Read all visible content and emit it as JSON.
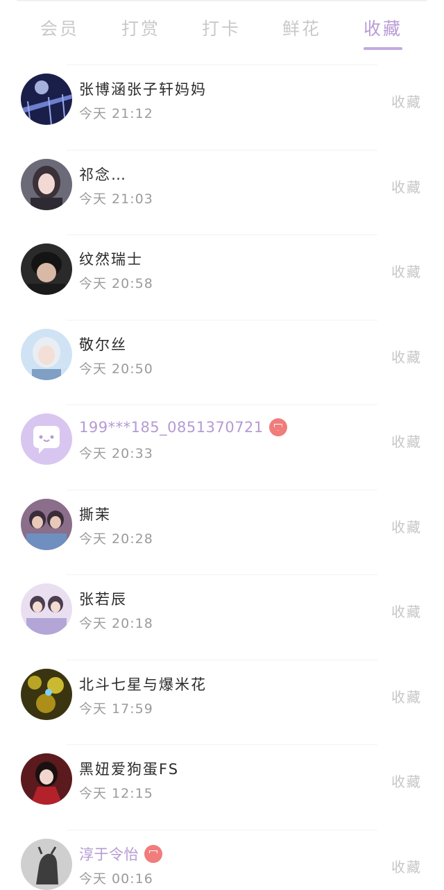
{
  "tabs": [
    {
      "label": "会员",
      "active": false
    },
    {
      "label": "打赏",
      "active": false
    },
    {
      "label": "打卡",
      "active": false
    },
    {
      "label": "鲜花",
      "active": false
    },
    {
      "label": "收藏",
      "active": true
    }
  ],
  "accent_color": "#b89bd6",
  "vip_badge_color": "#f07c7c",
  "items": [
    {
      "name": "张博涵张子轩妈妈",
      "time": "今天 21:12",
      "action": "收藏",
      "vip": false,
      "avatar": "night-bridge-photo"
    },
    {
      "name": "祁念…",
      "time": "今天 21:03",
      "action": "收藏",
      "vip": false,
      "avatar": "girl-portrait-photo"
    },
    {
      "name": "纹然瑞士",
      "time": "今天 20:58",
      "action": "收藏",
      "vip": false,
      "avatar": "boy-portrait-photo"
    },
    {
      "name": "敬尔丝",
      "time": "今天 20:50",
      "action": "收藏",
      "vip": false,
      "avatar": "light-hair-girl-photo"
    },
    {
      "name": "199***185_0851370721",
      "time": "今天 20:33",
      "action": "收藏",
      "vip": true,
      "avatar": "default-chat-bubble-icon"
    },
    {
      "name": "撕茉",
      "time": "今天 20:28",
      "action": "收藏",
      "vip": false,
      "avatar": "two-people-photo"
    },
    {
      "name": "张若辰",
      "time": "今天 20:18",
      "action": "收藏",
      "vip": false,
      "avatar": "two-people-pastel-photo"
    },
    {
      "name": "北斗七星与爆米花",
      "time": "今天 17:59",
      "action": "收藏",
      "vip": false,
      "avatar": "golden-lights-photo"
    },
    {
      "name": "黑妞爱狗蛋FS",
      "time": "今天 12:15",
      "action": "收藏",
      "vip": false,
      "avatar": "red-dress-photo"
    },
    {
      "name": "淳于令怡",
      "time": "今天 00:16",
      "action": "收藏",
      "vip": true,
      "avatar": "bronze-statue-photo"
    }
  ]
}
